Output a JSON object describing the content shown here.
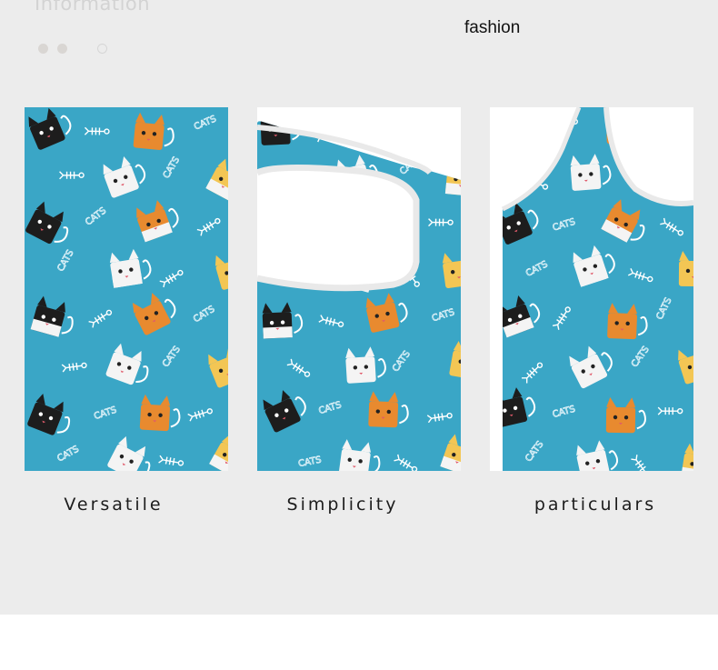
{
  "header": {
    "ghost_title": "Information",
    "tagline": "fashion"
  },
  "carousel": {
    "dots": [
      {
        "state": "filled"
      },
      {
        "state": "filled"
      },
      {
        "state": "hollow"
      }
    ]
  },
  "gallery": {
    "fabric_color": "#3aa6c6",
    "items": [
      {
        "caption": "Versatile",
        "view": "flat fabric swatch"
      },
      {
        "caption": "Simplicity",
        "view": "bag opening"
      },
      {
        "caption": "particulars",
        "view": "bag handle"
      }
    ]
  },
  "print": {
    "text": "CATS"
  },
  "colors": {
    "background_panel": "#ececec",
    "fabric": "#3aa6c6",
    "cat_black": "#1d1d1d",
    "cat_white": "#f4f4f4",
    "cat_orange": "#e88a2f",
    "cat_yellow": "#f3c654"
  }
}
